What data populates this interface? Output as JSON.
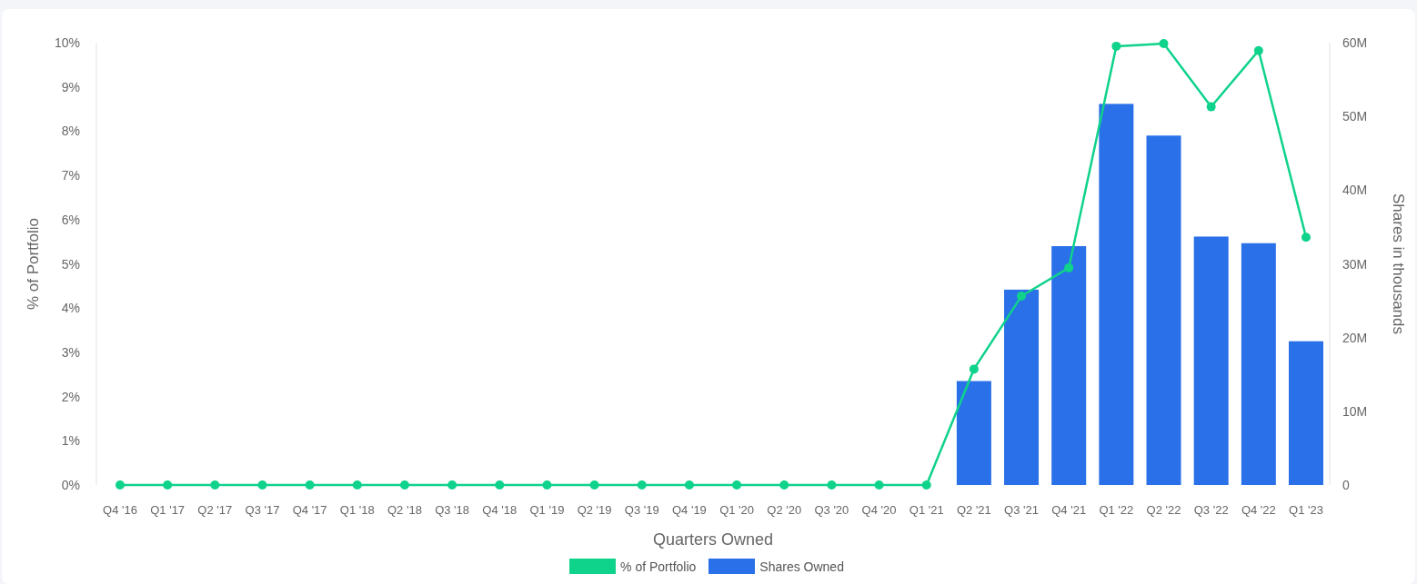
{
  "chart_data": {
    "type": "bar",
    "xlabel": "Quarters Owned",
    "ylabel": "% of Portfolio",
    "y2label": "Shares in thousands",
    "categories": [
      "Q4 '16",
      "Q1 '17",
      "Q2 '17",
      "Q3 '17",
      "Q4 '17",
      "Q1 '18",
      "Q2 '18",
      "Q3 '18",
      "Q4 '18",
      "Q1 '19",
      "Q2 '19",
      "Q3 '19",
      "Q4 '19",
      "Q1 '20",
      "Q2 '20",
      "Q3 '20",
      "Q4 '20",
      "Q1 '21",
      "Q2 '21",
      "Q3 '21",
      "Q4 '21",
      "Q1 '22",
      "Q2 '22",
      "Q3 '22",
      "Q4 '22",
      "Q1 '23"
    ],
    "series": [
      {
        "name": "% of Portfolio",
        "color": "#0fd28b",
        "type": "line",
        "marker": "circle",
        "values": [
          0,
          0,
          0,
          0,
          0,
          0,
          0,
          0,
          0,
          0,
          0,
          0,
          0,
          0,
          0,
          0,
          0,
          0,
          2.62,
          4.27,
          4.91,
          9.92,
          9.98,
          8.55,
          9.82,
          5.6
        ]
      },
      {
        "name": "Shares Owned",
        "color": "#2a70e8",
        "axis": "y2",
        "values": [
          0,
          0,
          0,
          0,
          0,
          0,
          0,
          0,
          0,
          0,
          0,
          0,
          0,
          0,
          0,
          0,
          0,
          0,
          14.1,
          26.5,
          32.4,
          51.7,
          47.4,
          33.7,
          32.8,
          19.5
        ]
      }
    ],
    "legend": "bottom",
    "ylim": [
      0,
      10
    ],
    "y2lim": [
      0,
      60
    ],
    "yticks": [
      {
        "value": 0,
        "label": "0%"
      },
      {
        "value": 1,
        "label": "1%"
      },
      {
        "value": 2,
        "label": "2%"
      },
      {
        "value": 3,
        "label": "3%"
      },
      {
        "value": 4,
        "label": "4%"
      },
      {
        "value": 5,
        "label": "5%"
      },
      {
        "value": 6,
        "label": "6%"
      },
      {
        "value": 7,
        "label": "7%"
      },
      {
        "value": 8,
        "label": "8%"
      },
      {
        "value": 9,
        "label": "9%"
      },
      {
        "value": 10,
        "label": "10%"
      }
    ],
    "y2ticks": [
      {
        "value": 0,
        "label": "0"
      },
      {
        "value": 10,
        "label": "10M"
      },
      {
        "value": 20,
        "label": "20M"
      },
      {
        "value": 30,
        "label": "30M"
      },
      {
        "value": 40,
        "label": "40M"
      },
      {
        "value": 50,
        "label": "50M"
      },
      {
        "value": 60,
        "label": "60M"
      }
    ]
  }
}
